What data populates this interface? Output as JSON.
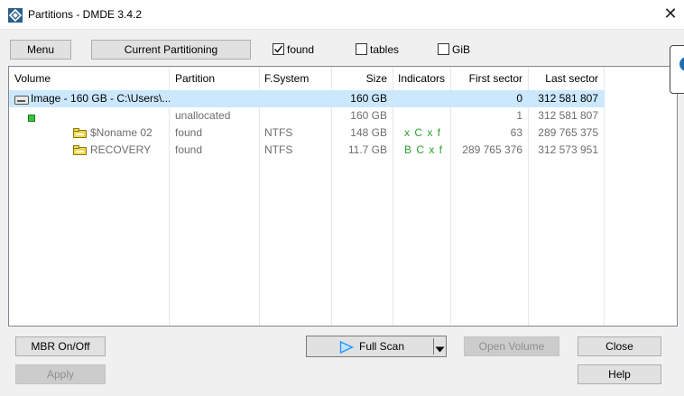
{
  "window": {
    "title": "Partitions - DMDE 3.4.2"
  },
  "toolbar": {
    "menu_label": "Menu",
    "current_partitioning_label": "Current Partitioning",
    "found_label": "found",
    "found_checked": true,
    "tables_label": "tables",
    "tables_checked": false,
    "gib_label": "GiB",
    "gib_checked": false
  },
  "table": {
    "columns": [
      "Volume",
      "Partition",
      "F.System",
      "Size",
      "Indicators",
      "First sector",
      "Last sector"
    ],
    "rows": [
      {
        "volume": "Image - 160 GB - C:\\Users\\...",
        "partition": "",
        "fsystem": "",
        "size": "160 GB",
        "indicators": "",
        "first": "0",
        "last": "312 581 807",
        "icon": "disk-image-icon",
        "selected": true
      },
      {
        "volume": "",
        "partition": "unallocated",
        "fsystem": "",
        "size": "160 GB",
        "indicators": "",
        "first": "1",
        "last": "312 581 807",
        "icon": "unallocated-space-icon",
        "selected": false
      },
      {
        "volume": "$Noname 02",
        "partition": "found",
        "fsystem": "NTFS",
        "size": "148 GB",
        "indicators": "x C x f",
        "first": "63",
        "last": "289 765 375",
        "icon": "found-volume-icon",
        "selected": false
      },
      {
        "volume": "RECOVERY",
        "partition": "found",
        "fsystem": "NTFS",
        "size": "11.7 GB",
        "indicators": "B C x f",
        "first": "289 765 376",
        "last": "312 573 951",
        "icon": "found-volume-icon",
        "selected": false
      }
    ]
  },
  "buttons": {
    "mbr_label": "MBR On/Off",
    "apply_label": "Apply",
    "full_scan_label": "Full Scan",
    "open_volume_label": "Open Volume",
    "close_label": "Close",
    "help_label": "Help"
  },
  "colors": {
    "selection": "#cce8ff",
    "indicator_green": "#2ca02c",
    "accent": "#1e90ff"
  }
}
